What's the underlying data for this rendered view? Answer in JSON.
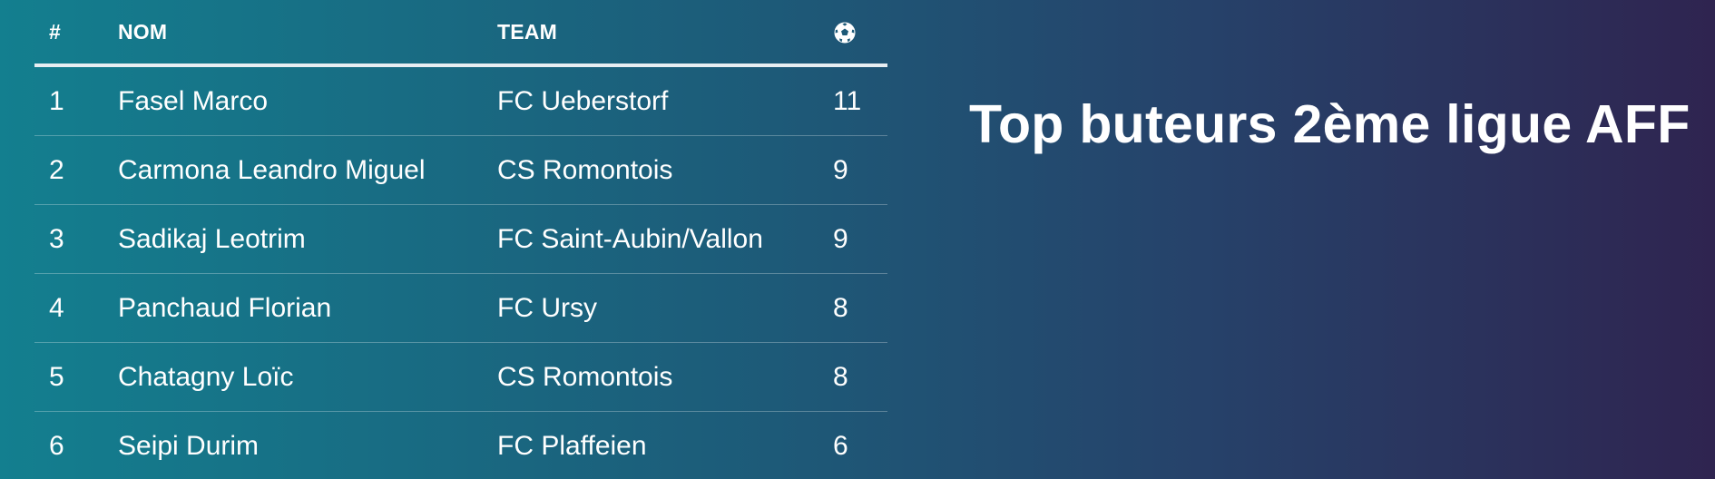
{
  "title": "Top buteurs 2ème ligue AFF",
  "table": {
    "headers": {
      "rank": "#",
      "name": "NOM",
      "team": "TEAM",
      "goals_icon": "soccer-ball-icon"
    },
    "rows": [
      {
        "rank": "1",
        "name": "Fasel Marco",
        "team": "FC Ueberstorf",
        "goals": "11"
      },
      {
        "rank": "2",
        "name": "Carmona Leandro Miguel",
        "team": "CS Romontois",
        "goals": "9"
      },
      {
        "rank": "3",
        "name": "Sadikaj Leotrim",
        "team": "FC Saint-Aubin/Vallon",
        "goals": "9"
      },
      {
        "rank": "4",
        "name": "Panchaud Florian",
        "team": "FC Ursy",
        "goals": "8"
      },
      {
        "rank": "5",
        "name": "Chatagny Loïc",
        "team": "CS Romontois",
        "goals": "8"
      },
      {
        "rank": "6",
        "name": "Seipi Durim",
        "team": "FC Plaffeien",
        "goals": "6"
      }
    ]
  },
  "colors": {
    "gradient_start": "#137f8f",
    "gradient_end": "#2f2450",
    "text": "#ffffff"
  }
}
